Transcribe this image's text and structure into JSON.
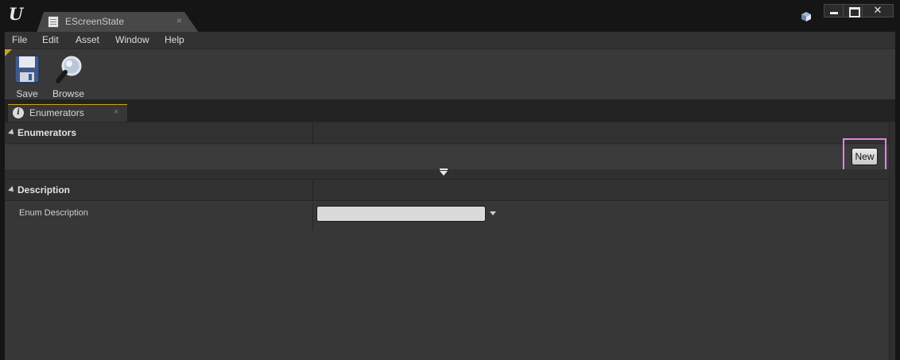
{
  "window": {
    "document_tab": "EScreenState",
    "tab_close": "×"
  },
  "menu": {
    "items": [
      "File",
      "Edit",
      "Asset",
      "Window",
      "Help"
    ]
  },
  "toolbar": {
    "save_label": "Save",
    "browse_label": "Browse"
  },
  "panel_tab": {
    "label": "Enumerators",
    "close": "×",
    "icon": "info-icon"
  },
  "details": {
    "enumerators_section": "Enumerators",
    "new_button": "New",
    "description_section": "Description",
    "enum_description_label": "Enum Description",
    "enum_description_value": ""
  },
  "colors": {
    "accent": "#c9a21d",
    "highlight": "#e87fe3",
    "panel": "#373737"
  }
}
